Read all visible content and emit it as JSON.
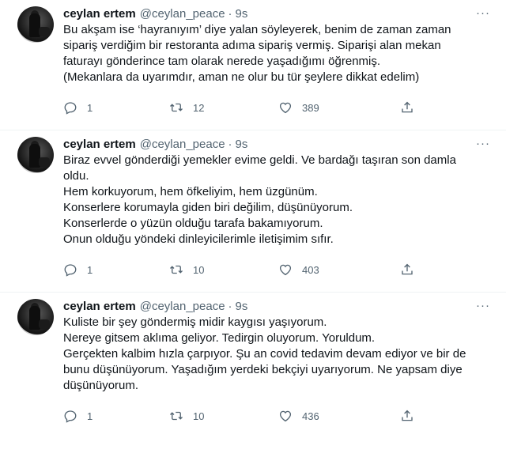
{
  "tweets": [
    {
      "name": "ceylan ertem",
      "handle": "@ceylan_peace",
      "separator": "·",
      "time": "9s",
      "more": "···",
      "lines": [
        "Bu akşam ise ‘hayranıyım’ diye yalan söyleyerek, benim de zaman zaman",
        "sipariş verdiğim bir restoranta adıma sipariş vermiş. Siparişi alan mekan",
        "faturayı gönderince tam olarak nerede yaşadığımı öğrenmiş.",
        "(Mekanlara da uyarımdır, aman ne olur bu tür şeylere dikkat edelim)"
      ],
      "replies": "1",
      "retweets": "12",
      "likes": "389"
    },
    {
      "name": "ceylan ertem",
      "handle": "@ceylan_peace",
      "separator": "·",
      "time": "9s",
      "more": "···",
      "lines": [
        "Biraz evvel gönderdiği yemekler evime geldi. Ve bardağı taşıran son damla",
        "oldu.",
        "Hem korkuyorum, hem öfkeliyim, hem üzgünüm.",
        "Konserlere korumayla giden biri değilim, düşünüyorum.",
        "Konserlerde o yüzün olduğu tarafa bakamıyorum.",
        "Onun olduğu yöndeki dinleyicilerimle iletişimim sıfır."
      ],
      "replies": "1",
      "retweets": "10",
      "likes": "403"
    },
    {
      "name": "ceylan ertem",
      "handle": "@ceylan_peace",
      "separator": "·",
      "time": "9s",
      "more": "···",
      "lines": [
        "Kuliste bir şey göndermiş midir kaygısı yaşıyorum.",
        "Nereye gitsem aklıma geliyor. Tedirgin oluyorum. Yoruldum.",
        "Gerçekten kalbim hızla çarpıyor. Şu an covid tedavim devam ediyor ve bir de",
        "bunu düşünüyorum. Yaşadığım yerdeki bekçiyi uyarıyorum. Ne yapsam diye",
        "düşünüyorum."
      ],
      "replies": "1",
      "retweets": "10",
      "likes": "436"
    }
  ],
  "icons": {
    "reply": "reply-icon",
    "retweet": "retweet-icon",
    "like": "heart-icon",
    "share": "share-icon",
    "more": "more-icon"
  },
  "colors": {
    "text": "#0f1419",
    "secondary": "#536471",
    "divider": "#eff3f4"
  }
}
